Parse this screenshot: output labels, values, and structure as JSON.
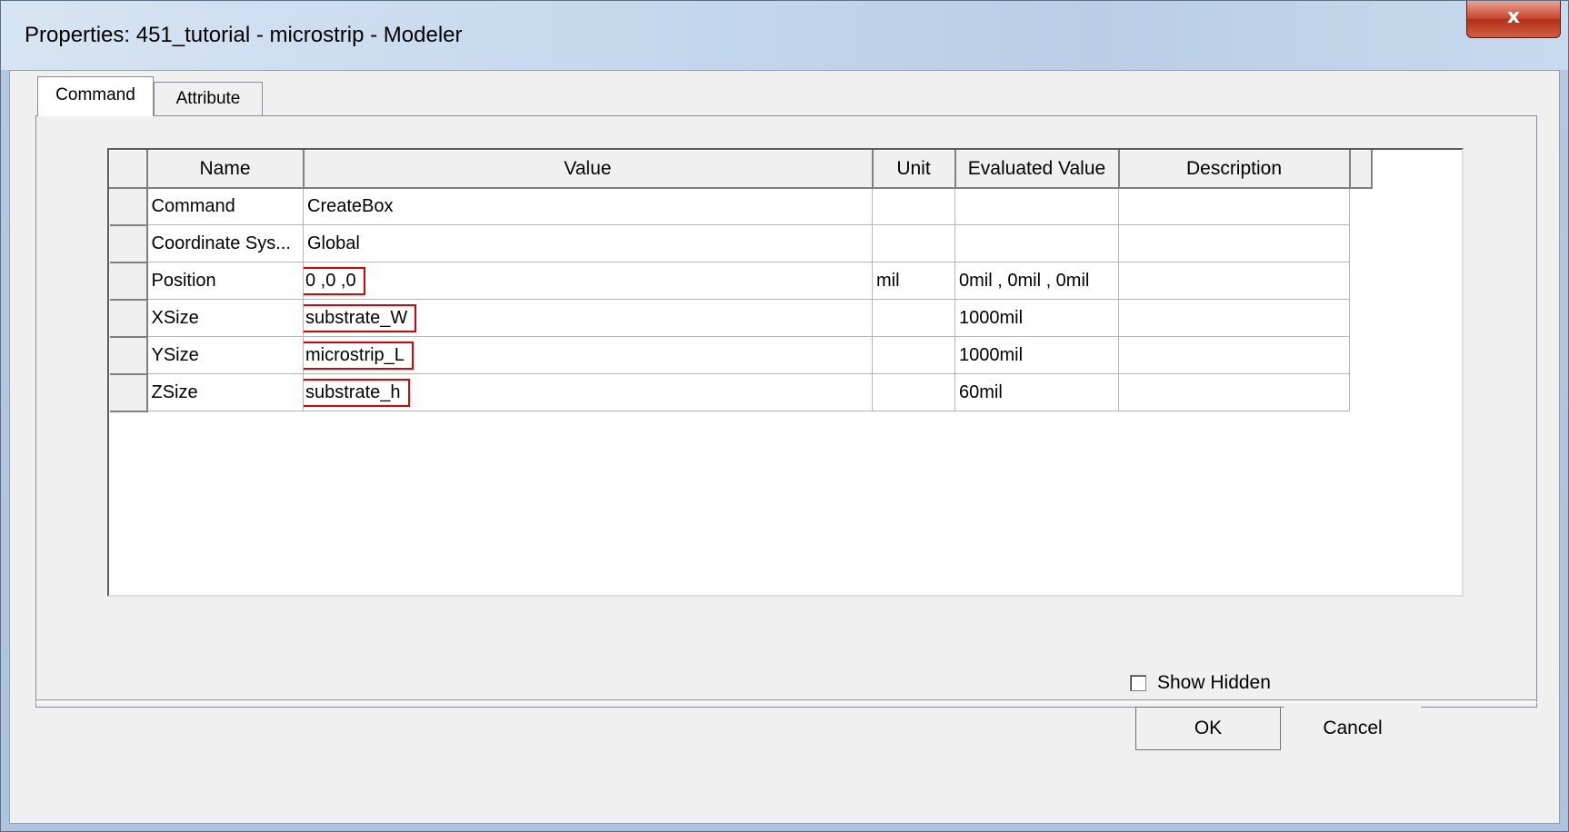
{
  "window": {
    "title": "Properties: 451_tutorial - microstrip - Modeler",
    "close_label": "x"
  },
  "tabs": [
    {
      "label": "Command",
      "active": true
    },
    {
      "label": "Attribute",
      "active": false
    }
  ],
  "table": {
    "columns": [
      "Name",
      "Value",
      "Unit",
      "Evaluated Value",
      "Description"
    ],
    "rows": [
      {
        "name": "Command",
        "value": "CreateBox",
        "unit": "",
        "evaluated": "",
        "description": "",
        "highlighted": false
      },
      {
        "name": "Coordinate Sys...",
        "value": "Global",
        "unit": "",
        "evaluated": "",
        "description": "",
        "highlighted": false
      },
      {
        "name": "Position",
        "value": "0 ,0 ,0",
        "unit": "mil",
        "evaluated": "0mil , 0mil , 0mil",
        "description": "",
        "highlighted": true
      },
      {
        "name": "XSize",
        "value": "substrate_W",
        "unit": "",
        "evaluated": "1000mil",
        "description": "",
        "highlighted": true
      },
      {
        "name": "YSize",
        "value": "microstrip_L",
        "unit": "",
        "evaluated": "1000mil",
        "description": "",
        "highlighted": true
      },
      {
        "name": "ZSize",
        "value": "substrate_h",
        "unit": "",
        "evaluated": "60mil",
        "description": "",
        "highlighted": true
      }
    ]
  },
  "show_hidden": {
    "label": "Show Hidden",
    "checked": false
  },
  "buttons": {
    "ok": "OK",
    "cancel": "Cancel"
  },
  "highlight_color": "#e00000"
}
